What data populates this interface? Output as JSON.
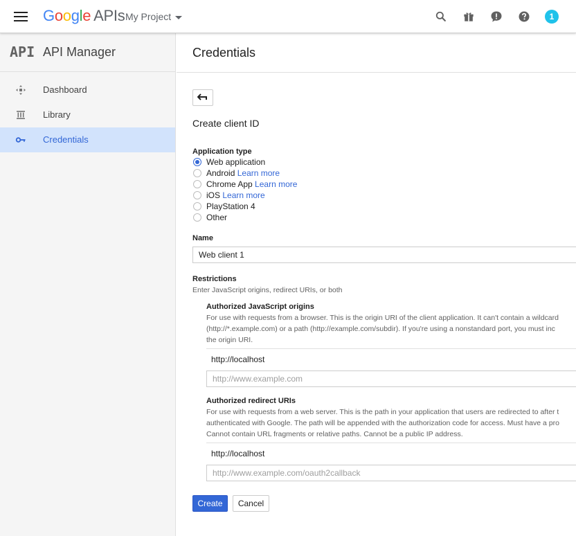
{
  "topbar": {
    "logo": {
      "g1": "G",
      "o1": "o",
      "o2": "o",
      "g2": "g",
      "l": "l",
      "e": "e",
      "apis": "APIs"
    },
    "project": "My Project",
    "notifications": "1",
    "icons": [
      "search-icon",
      "gift-icon",
      "feedback-icon",
      "help-icon"
    ]
  },
  "sidebar": {
    "logo": "API",
    "title": "API Manager",
    "items": [
      {
        "label": "Dashboard",
        "icon": "dashboard-icon"
      },
      {
        "label": "Library",
        "icon": "library-icon"
      },
      {
        "label": "Credentials",
        "icon": "key-icon",
        "active": true
      }
    ]
  },
  "main": {
    "title": "Credentials",
    "section_title": "Create client ID",
    "app_type": {
      "label": "Application type",
      "options": [
        {
          "label": "Web application",
          "checked": true
        },
        {
          "label": "Android",
          "link": "Learn more"
        },
        {
          "label": "Chrome App",
          "link": "Learn more"
        },
        {
          "label": "iOS",
          "link": "Learn more"
        },
        {
          "label": "PlayStation 4"
        },
        {
          "label": "Other"
        }
      ]
    },
    "name": {
      "label": "Name",
      "value": "Web client 1"
    },
    "restrictions": {
      "label": "Restrictions",
      "help": "Enter JavaScript origins, redirect URIs, or both",
      "js_origins": {
        "label": "Authorized JavaScript origins",
        "help": [
          "For use with requests from a browser. This is the origin URI of the client application. It can't contain a wildcard",
          "(http://*.example.com) or a path (http://example.com/subdir). If you're using a nonstandard port, you must inc",
          "the origin URI."
        ],
        "value": "http://localhost",
        "placeholder": "http://www.example.com"
      },
      "redirect_uris": {
        "label": "Authorized redirect URIs",
        "help": [
          "For use with requests from a web server. This is the path in your application that users are redirected to after t",
          "authenticated with Google. The path will be appended with the authorization code for access. Must have a pro",
          "Cannot contain URL fragments or relative paths. Cannot be a public IP address."
        ],
        "value": "http://localhost",
        "placeholder": "http://www.example.com/oauth2callback"
      }
    },
    "buttons": {
      "create": "Create",
      "cancel": "Cancel"
    }
  }
}
